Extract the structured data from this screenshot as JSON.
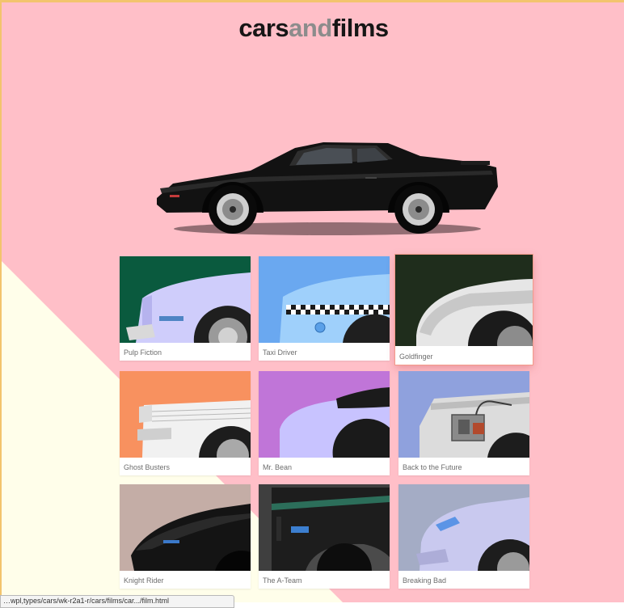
{
  "header": {
    "logo_part1": "cars",
    "logo_part2": "and",
    "logo_part3": "films"
  },
  "films": [
    {
      "title": "Pulp Fiction"
    },
    {
      "title": "Taxi Driver"
    },
    {
      "title": "Goldfinger"
    },
    {
      "title": "Ghost Busters"
    },
    {
      "title": "Mr. Bean"
    },
    {
      "title": "Back to the Future"
    },
    {
      "title": "Knight Rider"
    },
    {
      "title": "The A-Team"
    },
    {
      "title": "Breaking Bad"
    }
  ],
  "colors": {
    "page_background": "#ffbfc8",
    "diagonal_band": "#fffeea",
    "logo_dark": "#161616",
    "logo_accent": "#8c8c8c"
  },
  "status": {
    "url_fragment": "…wpl,types/cars/wk-r2a1-r/cars/films/car.../film.html"
  }
}
